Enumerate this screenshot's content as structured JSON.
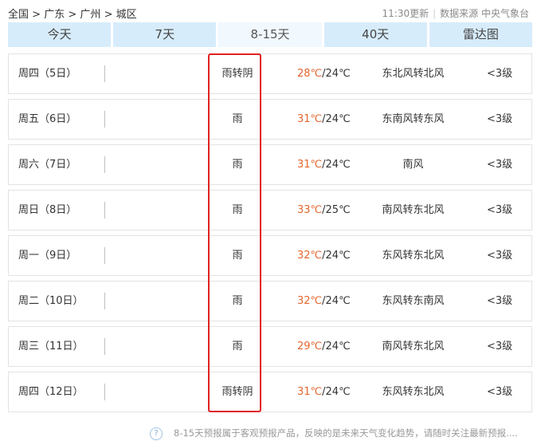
{
  "breadcrumb": {
    "items": [
      "全国",
      "广东",
      "广州",
      "城区"
    ],
    "separator": ">"
  },
  "source": {
    "updated": "11:30更新",
    "provider": "数据来源 中央气象台"
  },
  "tabs": [
    {
      "label": "今天",
      "active": false
    },
    {
      "label": "7天",
      "active": false
    },
    {
      "label": "8-15天",
      "active": true
    },
    {
      "label": "40天",
      "active": false
    },
    {
      "label": "雷达图",
      "active": false
    }
  ],
  "forecast": [
    {
      "day": "周四（5日）",
      "weather": "雨转阴",
      "high": "28℃",
      "low": "/24℃",
      "wind": "东北风转北风",
      "level": "<3级"
    },
    {
      "day": "周五（6日）",
      "weather": "雨",
      "high": "31℃",
      "low": "/24℃",
      "wind": "东南风转东风",
      "level": "<3级"
    },
    {
      "day": "周六（7日）",
      "weather": "雨",
      "high": "31℃",
      "low": "/24℃",
      "wind": "南风",
      "level": "<3级"
    },
    {
      "day": "周日（8日）",
      "weather": "雨",
      "high": "33℃",
      "low": "/25℃",
      "wind": "南风转东北风",
      "level": "<3级"
    },
    {
      "day": "周一（9日）",
      "weather": "雨",
      "high": "32℃",
      "low": "/24℃",
      "wind": "东风转东北风",
      "level": "<3级"
    },
    {
      "day": "周二（10日）",
      "weather": "雨",
      "high": "32℃",
      "low": "/24℃",
      "wind": "东风转东南风",
      "level": "<3级"
    },
    {
      "day": "周三（11日）",
      "weather": "雨",
      "high": "29℃",
      "low": "/24℃",
      "wind": "南风转东北风",
      "level": "<3级"
    },
    {
      "day": "周四（12日）",
      "weather": "雨转阴",
      "high": "31℃",
      "low": "/24℃",
      "wind": "东风转东北风",
      "level": "<3级"
    }
  ],
  "note": {
    "icon": "help-icon",
    "icon_glyph": "?",
    "text": "8-15天预报属于客观预报产品，反映的是未来天气变化趋势，请随时关注最新预报...."
  },
  "colors": {
    "tab_bg": "#d7ecfb",
    "tab_active_bg": "#f1f8fe",
    "high_temp": "#e5662f",
    "highlight_border": "#e02222"
  }
}
